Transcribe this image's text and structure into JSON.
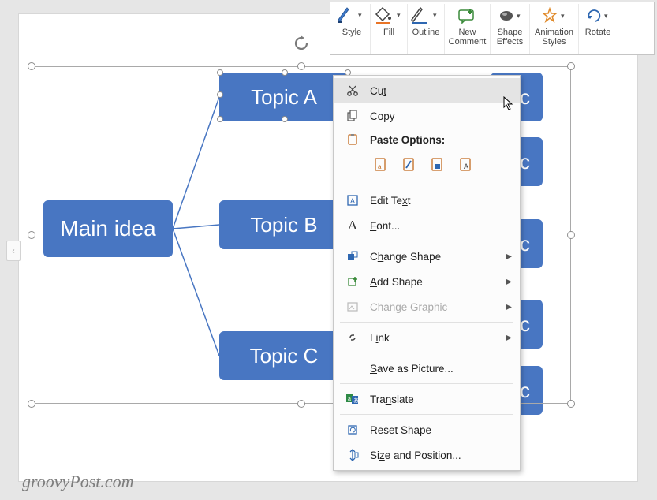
{
  "toolbar": {
    "style": "Style",
    "fill": "Fill",
    "outline": "Outline",
    "new_comment": "New\nComment",
    "shape_effects": "Shape\nEffects",
    "animation_styles": "Animation\nStyles",
    "rotate": "Rotate"
  },
  "diagram": {
    "main": "Main idea",
    "topics": [
      "Topic A",
      "Topic B",
      "Topic C"
    ],
    "rcol_suffix": "c"
  },
  "context_menu": {
    "cut": "Cut",
    "copy": "Copy",
    "paste_options": "Paste Options:",
    "edit_text": "Edit Text",
    "font": "Font...",
    "change_shape": "Change Shape",
    "add_shape": "Add Shape",
    "change_graphic": "Change Graphic",
    "link": "Link",
    "save_as_picture": "Save as Picture...",
    "translate": "Translate",
    "reset_shape": "Reset Shape",
    "size_position": "Size and Position..."
  },
  "watermark": "groovyPost.com"
}
